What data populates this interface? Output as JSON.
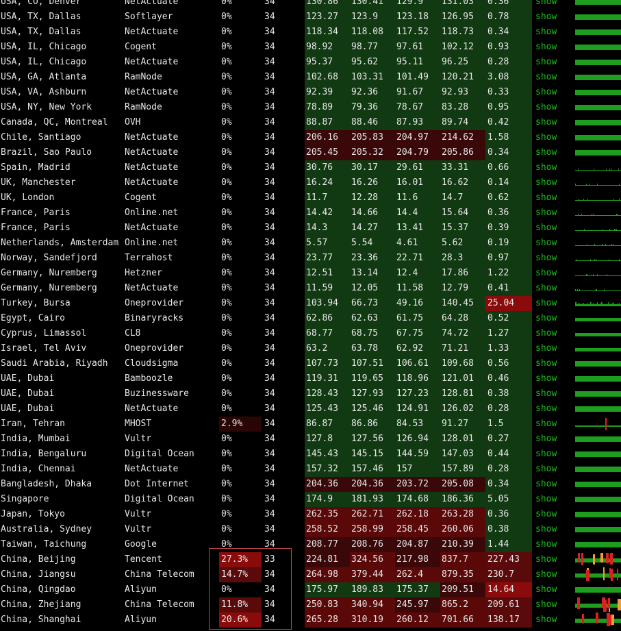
{
  "colors": {
    "ping_green": "#123a12",
    "ping_dark_red": "#3a0808",
    "ping_red": "#5a0808",
    "loss_mid": "#5a0a0a",
    "loss_high": "#8a0b0b",
    "loss_low": "#2a0505",
    "show_link": "#19c019",
    "bar_green": "#1e9e1e",
    "bar_red": "#e02020",
    "bar_orange": "#f0a030",
    "highlight_border": "#c44848"
  },
  "rows": [
    {
      "location": "USA, CO, Denver",
      "provider": "NetActuate",
      "loss": "0%",
      "snt": "34",
      "last": "130.86",
      "avg": "130.41",
      "best": "129.9",
      "wrst": "131.03",
      "stdev": "0.36",
      "show": "show",
      "spark": "solid"
    },
    {
      "location": "USA, TX, Dallas",
      "provider": "Softlayer",
      "loss": "0%",
      "snt": "34",
      "last": "123.27",
      "avg": "123.9",
      "best": "123.18",
      "wrst": "126.95",
      "stdev": "0.78",
      "show": "show",
      "spark": "solid"
    },
    {
      "location": "USA, TX, Dallas",
      "provider": "NetActuate",
      "loss": "0%",
      "snt": "34",
      "last": "118.34",
      "avg": "118.08",
      "best": "117.52",
      "wrst": "118.73",
      "stdev": "0.34",
      "show": "show",
      "spark": "solid"
    },
    {
      "location": "USA, IL, Chicago",
      "provider": "Cogent",
      "loss": "0%",
      "snt": "34",
      "last": "98.92",
      "avg": "98.77",
      "best": "97.61",
      "wrst": "102.12",
      "stdev": "0.93",
      "show": "show",
      "spark": "solid"
    },
    {
      "location": "USA, IL, Chicago",
      "provider": "NetActuate",
      "loss": "0%",
      "snt": "34",
      "last": "95.37",
      "avg": "95.62",
      "best": "95.11",
      "wrst": "96.25",
      "stdev": "0.28",
      "show": "show",
      "spark": "solid"
    },
    {
      "location": "USA, GA, Atlanta",
      "provider": "RamNode",
      "loss": "0%",
      "snt": "34",
      "last": "102.68",
      "avg": "103.31",
      "best": "101.49",
      "wrst": "120.21",
      "stdev": "3.08",
      "show": "show",
      "spark": "solid"
    },
    {
      "location": "USA, VA, Ashburn",
      "provider": "NetActuate",
      "loss": "0%",
      "snt": "34",
      "last": "92.39",
      "avg": "92.36",
      "best": "91.67",
      "wrst": "92.93",
      "stdev": "0.33",
      "show": "show",
      "spark": "solid"
    },
    {
      "location": "USA, NY, New York",
      "provider": "RamNode",
      "loss": "0%",
      "snt": "34",
      "last": "78.89",
      "avg": "79.36",
      "best": "78.67",
      "wrst": "83.28",
      "stdev": "0.95",
      "show": "show",
      "spark": "solid"
    },
    {
      "location": "Canada, QC, Montreal",
      "provider": "OVH",
      "loss": "0%",
      "snt": "34",
      "last": "88.87",
      "avg": "88.46",
      "best": "87.93",
      "wrst": "89.74",
      "stdev": "0.42",
      "show": "show",
      "spark": "solid"
    },
    {
      "location": "Chile, Santiago",
      "provider": "NetActuate",
      "loss": "0%",
      "snt": "34",
      "last": "206.16",
      "avg": "205.83",
      "best": "204.97",
      "wrst": "214.62",
      "stdev": "1.58",
      "show": "show",
      "spark": "solid"
    },
    {
      "location": "Brazil, Sao Paulo",
      "provider": "NetActuate",
      "loss": "0%",
      "snt": "34",
      "last": "205.45",
      "avg": "205.32",
      "best": "204.79",
      "wrst": "205.86",
      "stdev": "0.34",
      "show": "show",
      "spark": "solid"
    },
    {
      "location": "Spain, Madrid",
      "provider": "NetActuate",
      "loss": "0%",
      "snt": "34",
      "last": "30.76",
      "avg": "30.17",
      "best": "29.61",
      "wrst": "33.31",
      "stdev": "0.66",
      "show": "show",
      "spark": "thin"
    },
    {
      "location": "UK, Manchester",
      "provider": "NetActuate",
      "loss": "0%",
      "snt": "34",
      "last": "16.24",
      "avg": "16.26",
      "best": "16.01",
      "wrst": "16.62",
      "stdev": "0.14",
      "show": "show",
      "spark": "thin"
    },
    {
      "location": "UK, London",
      "provider": "Cogent",
      "loss": "0%",
      "snt": "34",
      "last": "11.7",
      "avg": "12.28",
      "best": "11.6",
      "wrst": "14.7",
      "stdev": "0.62",
      "show": "show",
      "spark": "thin"
    },
    {
      "location": "France, Paris",
      "provider": "Online.net",
      "loss": "0%",
      "snt": "34",
      "last": "14.42",
      "avg": "14.66",
      "best": "14.4",
      "wrst": "15.64",
      "stdev": "0.36",
      "show": "show",
      "spark": "thin"
    },
    {
      "location": "France, Paris",
      "provider": "NetActuate",
      "loss": "0%",
      "snt": "34",
      "last": "14.3",
      "avg": "14.27",
      "best": "13.41",
      "wrst": "15.37",
      "stdev": "0.39",
      "show": "show",
      "spark": "thin"
    },
    {
      "location": "Netherlands, Amsterdam",
      "provider": "Online.net",
      "loss": "0%",
      "snt": "34",
      "last": "5.57",
      "avg": "5.54",
      "best": "4.61",
      "wrst": "5.62",
      "stdev": "0.19",
      "show": "show",
      "spark": "thin"
    },
    {
      "location": "Norway, Sandefjord",
      "provider": "Terrahost",
      "loss": "0%",
      "snt": "34",
      "last": "23.77",
      "avg": "23.36",
      "best": "22.71",
      "wrst": "28.3",
      "stdev": "0.97",
      "show": "show",
      "spark": "thin"
    },
    {
      "location": "Germany, Nuremberg",
      "provider": "Hetzner",
      "loss": "0%",
      "snt": "34",
      "last": "12.51",
      "avg": "13.14",
      "best": "12.4",
      "wrst": "17.86",
      "stdev": "1.22",
      "show": "show",
      "spark": "thin"
    },
    {
      "location": "Germany, Nuremberg",
      "provider": "NetActuate",
      "loss": "0%",
      "snt": "34",
      "last": "11.59",
      "avg": "12.05",
      "best": "11.58",
      "wrst": "12.79",
      "stdev": "0.41",
      "show": "show",
      "spark": "thin"
    },
    {
      "location": "Turkey, Bursa",
      "provider": "Oneprovider",
      "loss": "0%",
      "snt": "34",
      "last": "103.94",
      "avg": "66.73",
      "best": "49.16",
      "wrst": "140.45",
      "stdev": "25.04",
      "show": "show",
      "spark": "spiky"
    },
    {
      "location": "Egypt, Cairo",
      "provider": "Binaryracks",
      "loss": "0%",
      "snt": "34",
      "last": "62.86",
      "avg": "62.63",
      "best": "61.75",
      "wrst": "64.28",
      "stdev": "0.52",
      "show": "show",
      "spark": "half"
    },
    {
      "location": "Cyprus, Limassol",
      "provider": "CL8",
      "loss": "0%",
      "snt": "34",
      "last": "68.77",
      "avg": "68.75",
      "best": "67.75",
      "wrst": "74.72",
      "stdev": "1.27",
      "show": "show",
      "spark": "half"
    },
    {
      "location": "Israel, Tel Aviv",
      "provider": "Oneprovider",
      "loss": "0%",
      "snt": "34",
      "last": "63.2",
      "avg": "63.78",
      "best": "62.92",
      "wrst": "71.21",
      "stdev": "1.33",
      "show": "show",
      "spark": "half"
    },
    {
      "location": "Saudi Arabia, Riyadh",
      "provider": "Cloudsigma",
      "loss": "0%",
      "snt": "34",
      "last": "107.73",
      "avg": "107.51",
      "best": "106.61",
      "wrst": "109.68",
      "stdev": "0.56",
      "show": "show",
      "spark": "solid"
    },
    {
      "location": "UAE, Dubai",
      "provider": "Bamboozle",
      "loss": "0%",
      "snt": "34",
      "last": "119.31",
      "avg": "119.65",
      "best": "118.96",
      "wrst": "121.01",
      "stdev": "0.46",
      "show": "show",
      "spark": "solid"
    },
    {
      "location": "UAE, Dubai",
      "provider": "Buzinessware",
      "loss": "0%",
      "snt": "34",
      "last": "128.43",
      "avg": "127.93",
      "best": "127.23",
      "wrst": "128.81",
      "stdev": "0.38",
      "show": "show",
      "spark": "solid"
    },
    {
      "location": "UAE, Dubai",
      "provider": "NetActuate",
      "loss": "0%",
      "snt": "34",
      "last": "125.43",
      "avg": "125.46",
      "best": "124.91",
      "wrst": "126.02",
      "stdev": "0.28",
      "show": "show",
      "spark": "solid"
    },
    {
      "location": "Iran, Tehran",
      "provider": "MHOST",
      "loss": "2.9%",
      "snt": "34",
      "last": "86.87",
      "avg": "86.86",
      "best": "84.53",
      "wrst": "91.27",
      "stdev": "1.5",
      "show": "show",
      "spark": "loss"
    },
    {
      "location": "India, Mumbai",
      "provider": "Vultr",
      "loss": "0%",
      "snt": "34",
      "last": "127.8",
      "avg": "127.56",
      "best": "126.94",
      "wrst": "128.01",
      "stdev": "0.27",
      "show": "show",
      "spark": "solid"
    },
    {
      "location": "India, Bengaluru",
      "provider": "Digital Ocean",
      "loss": "0%",
      "snt": "34",
      "last": "145.43",
      "avg": "145.15",
      "best": "144.59",
      "wrst": "147.03",
      "stdev": "0.44",
      "show": "show",
      "spark": "solid"
    },
    {
      "location": "India, Chennai",
      "provider": "NetActuate",
      "loss": "0%",
      "snt": "34",
      "last": "157.32",
      "avg": "157.46",
      "best": "157",
      "wrst": "157.89",
      "stdev": "0.28",
      "show": "show",
      "spark": "solid"
    },
    {
      "location": "Bangladesh, Dhaka",
      "provider": "Dot Internet",
      "loss": "0%",
      "snt": "34",
      "last": "204.36",
      "avg": "204.36",
      "best": "203.72",
      "wrst": "205.08",
      "stdev": "0.34",
      "show": "show",
      "spark": "solid"
    },
    {
      "location": "Singapore",
      "provider": "Digital Ocean",
      "loss": "0%",
      "snt": "34",
      "last": "174.9",
      "avg": "181.93",
      "best": "174.68",
      "wrst": "186.36",
      "stdev": "5.05",
      "show": "show",
      "spark": "solid"
    },
    {
      "location": "Japan, Tokyo",
      "provider": "Vultr",
      "loss": "0%",
      "snt": "34",
      "last": "262.35",
      "avg": "262.71",
      "best": "262.18",
      "wrst": "263.28",
      "stdev": "0.36",
      "show": "show",
      "spark": "solid"
    },
    {
      "location": "Australia, Sydney",
      "provider": "Vultr",
      "loss": "0%",
      "snt": "34",
      "last": "258.52",
      "avg": "258.99",
      "best": "258.45",
      "wrst": "260.06",
      "stdev": "0.38",
      "show": "show",
      "spark": "solid"
    },
    {
      "location": "Taiwan, Taichung",
      "provider": "Google",
      "loss": "0%",
      "snt": "34",
      "last": "208.77",
      "avg": "208.76",
      "best": "204.87",
      "wrst": "210.39",
      "stdev": "1.44",
      "show": "show",
      "spark": "solid"
    },
    {
      "location": "China, Beijing",
      "provider": "Tencent",
      "loss": "27.3%",
      "snt": "33",
      "last": "224.81",
      "avg": "324.56",
      "best": "217.98",
      "wrst": "837.7",
      "stdev": "227.43",
      "show": "show",
      "spark": "chaos"
    },
    {
      "location": "China, Jiangsu",
      "provider": "China Telecom",
      "loss": "14.7%",
      "snt": "34",
      "last": "264.98",
      "avg": "379.44",
      "best": "262.4",
      "wrst": "879.35",
      "stdev": "230.7",
      "show": "show",
      "spark": "chaos"
    },
    {
      "location": "China, Qingdao",
      "provider": "Aliyun",
      "loss": "0%",
      "snt": "34",
      "last": "175.97",
      "avg": "189.83",
      "best": "175.37",
      "wrst": "209.51",
      "stdev": "14.64",
      "show": "show",
      "spark": "solid"
    },
    {
      "location": "China, Zhejiang",
      "provider": "China Telecom",
      "loss": "11.8%",
      "snt": "34",
      "last": "250.83",
      "avg": "340.94",
      "best": "245.97",
      "wrst": "865.2",
      "stdev": "209.61",
      "show": "show",
      "spark": "chaos"
    },
    {
      "location": "China, Shanghai",
      "provider": "Aliyun",
      "loss": "20.6%",
      "snt": "34",
      "last": "265.28",
      "avg": "310.19",
      "best": "260.12",
      "wrst": "701.66",
      "stdev": "138.17",
      "show": "show",
      "spark": "chaos"
    }
  ]
}
